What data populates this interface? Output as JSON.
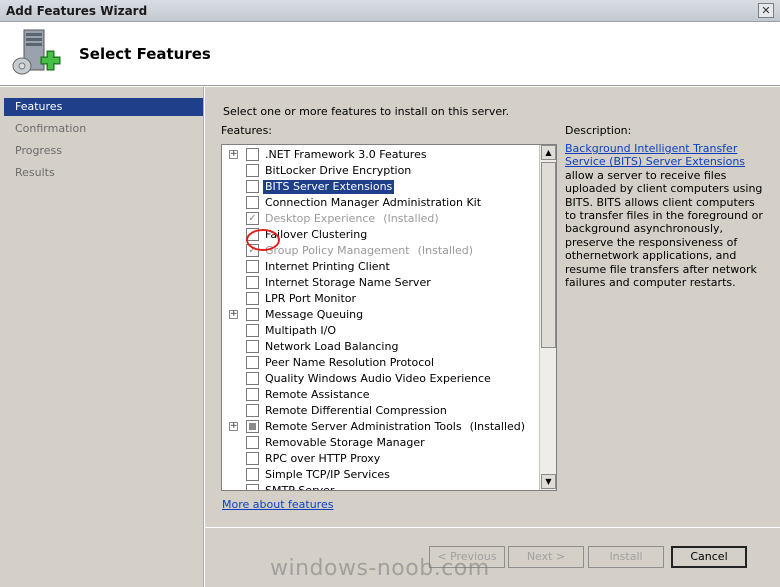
{
  "window": {
    "title": "Add Features Wizard",
    "close_glyph": "✕"
  },
  "header": {
    "heading": "Select Features",
    "icon": "server-add-icon"
  },
  "sidebar": {
    "items": [
      {
        "label": "Features",
        "active": true
      },
      {
        "label": "Confirmation",
        "active": false
      },
      {
        "label": "Progress",
        "active": false
      },
      {
        "label": "Results",
        "active": false
      }
    ]
  },
  "main": {
    "instruction": "Select one or more features to install on this server.",
    "features_label": "Features:",
    "description_label": "Description:",
    "description_link": "Background Intelligent Transfer Service (BITS) Server Extensions",
    "description_text": "allow a server to receive files uploaded by client computers using BITS. BITS allows client computers to transfer files in the foreground or background asynchronously, preserve the responsiveness of othernetwork applications, and resume file transfers after network failures and computer restarts.",
    "more_link": "More about features"
  },
  "features": [
    {
      "name": ".NET Framework 3.0 Features",
      "expandable": true,
      "state": "unchecked"
    },
    {
      "name": "BitLocker Drive Encryption",
      "expandable": false,
      "state": "unchecked"
    },
    {
      "name": "BITS Server Extensions",
      "expandable": false,
      "state": "unchecked",
      "selected": true
    },
    {
      "name": "Connection Manager Administration Kit",
      "expandable": false,
      "state": "unchecked"
    },
    {
      "name": "Desktop Experience",
      "suffix": "(Installed)",
      "expandable": false,
      "state": "checked-disabled"
    },
    {
      "name": "Failover Clustering",
      "expandable": false,
      "state": "unchecked"
    },
    {
      "name": "Group Policy Management",
      "suffix": "(Installed)",
      "expandable": false,
      "state": "checked-disabled"
    },
    {
      "name": "Internet Printing Client",
      "expandable": false,
      "state": "unchecked"
    },
    {
      "name": "Internet Storage Name Server",
      "expandable": false,
      "state": "unchecked"
    },
    {
      "name": "LPR Port Monitor",
      "expandable": false,
      "state": "unchecked"
    },
    {
      "name": "Message Queuing",
      "expandable": true,
      "state": "unchecked"
    },
    {
      "name": "Multipath I/O",
      "expandable": false,
      "state": "unchecked"
    },
    {
      "name": "Network Load Balancing",
      "expandable": false,
      "state": "unchecked"
    },
    {
      "name": "Peer Name Resolution Protocol",
      "expandable": false,
      "state": "unchecked"
    },
    {
      "name": "Quality Windows Audio Video Experience",
      "expandable": false,
      "state": "unchecked"
    },
    {
      "name": "Remote Assistance",
      "expandable": false,
      "state": "unchecked"
    },
    {
      "name": "Remote Differential Compression",
      "expandable": false,
      "state": "unchecked"
    },
    {
      "name": "Remote Server Administration Tools",
      "suffix": "(Installed)",
      "expandable": true,
      "state": "partial"
    },
    {
      "name": "Removable Storage Manager",
      "expandable": false,
      "state": "unchecked"
    },
    {
      "name": "RPC over HTTP Proxy",
      "expandable": false,
      "state": "unchecked"
    },
    {
      "name": "Simple TCP/IP Services",
      "expandable": false,
      "state": "unchecked"
    },
    {
      "name": "SMTP Server",
      "expandable": false,
      "state": "unchecked"
    }
  ],
  "buttons": {
    "previous": "< Previous",
    "next": "Next >",
    "install": "Install",
    "cancel": "Cancel"
  },
  "watermark": "windows-noob.com",
  "colors": {
    "selection": "#1f3f8a",
    "link": "#0b3fbf",
    "annotation": "#e0201c"
  }
}
